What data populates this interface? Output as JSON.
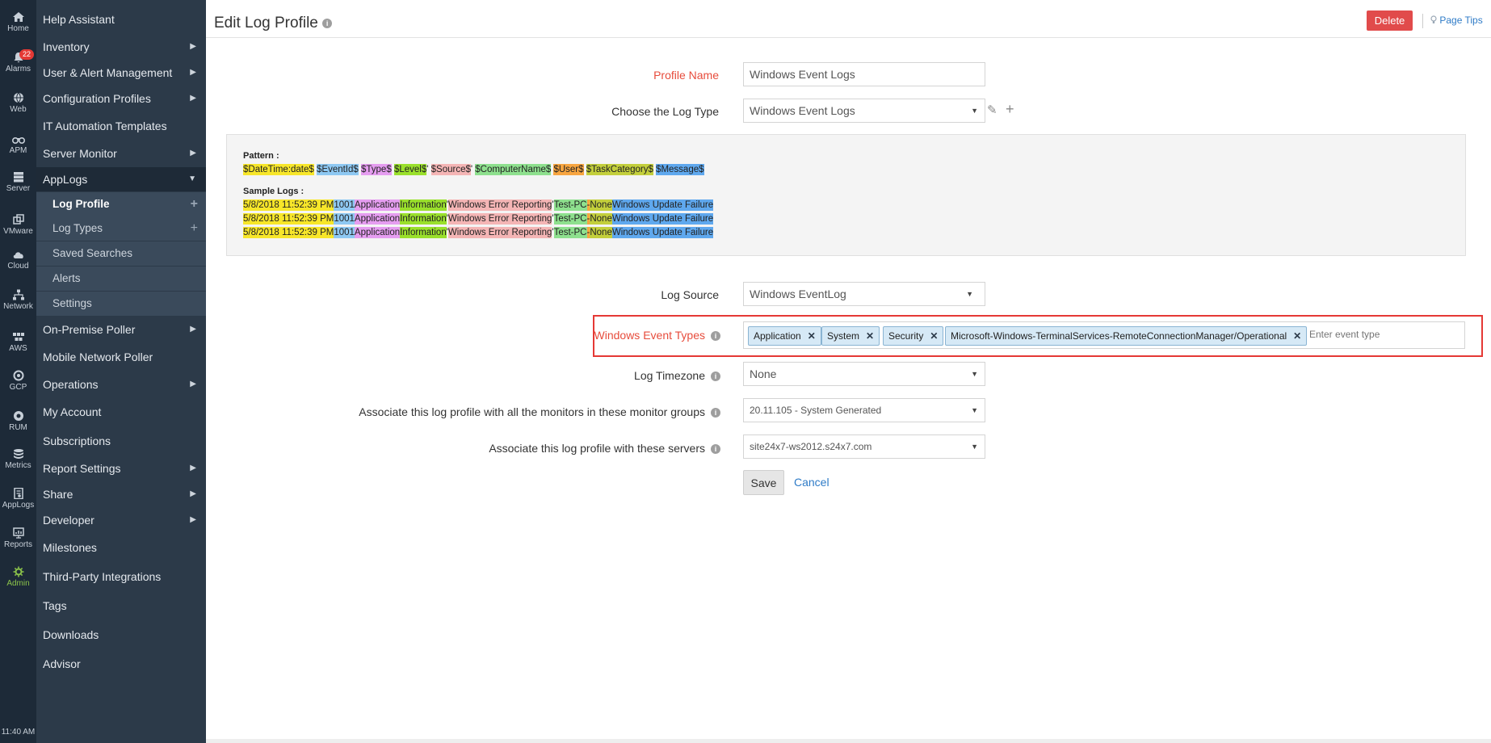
{
  "rail": [
    {
      "label": "Home",
      "icon": "home-icon"
    },
    {
      "label": "Alarms",
      "icon": "bell-icon",
      "badge": "22"
    },
    {
      "label": "Web",
      "icon": "globe-icon"
    },
    {
      "label": "APM",
      "icon": "binoculars-icon"
    },
    {
      "label": "Server",
      "icon": "server-icon"
    },
    {
      "label": "VMware",
      "icon": "vmware-icon"
    },
    {
      "label": "Cloud",
      "icon": "cloud-icon"
    },
    {
      "label": "Network",
      "icon": "network-icon"
    },
    {
      "label": "AWS",
      "icon": "aws-icon"
    },
    {
      "label": "GCP",
      "icon": "gcp-icon"
    },
    {
      "label": "RUM",
      "icon": "rum-icon"
    },
    {
      "label": "Metrics",
      "icon": "metrics-icon"
    },
    {
      "label": "AppLogs",
      "icon": "applogs-icon"
    },
    {
      "label": "Reports",
      "icon": "reports-icon"
    },
    {
      "label": "Admin",
      "icon": "gear-icon"
    }
  ],
  "clock": "11:40 AM",
  "menu": {
    "items": [
      {
        "label": "Help Assistant"
      },
      {
        "label": "Inventory"
      },
      {
        "label": "User & Alert Management"
      },
      {
        "label": "Configuration Profiles"
      },
      {
        "label": "IT Automation Templates"
      },
      {
        "label": "Server Monitor"
      },
      {
        "label": "AppLogs"
      },
      {
        "label": "Log Profile"
      },
      {
        "label": "Log Types"
      },
      {
        "label": "Saved Searches"
      },
      {
        "label": "Alerts"
      },
      {
        "label": "Settings"
      },
      {
        "label": "On-Premise Poller"
      },
      {
        "label": "Mobile Network Poller"
      },
      {
        "label": "Operations"
      },
      {
        "label": "My Account"
      },
      {
        "label": "Subscriptions"
      },
      {
        "label": "Report Settings"
      },
      {
        "label": "Share"
      },
      {
        "label": "Developer"
      },
      {
        "label": "Milestones"
      },
      {
        "label": "Third-Party Integrations"
      },
      {
        "label": "Tags"
      },
      {
        "label": "Downloads"
      },
      {
        "label": "Advisor"
      }
    ]
  },
  "header": {
    "title": "Edit Log Profile",
    "delete_label": "Delete",
    "page_tips_label": "Page Tips"
  },
  "form": {
    "profile_name_label": "Profile Name",
    "profile_name_value": "Windows Event Logs",
    "log_type_label": "Choose the Log Type",
    "log_type_value": "Windows Event Logs",
    "pattern_label": "Pattern :",
    "pattern": {
      "datetime": "$DateTime:date$",
      "eventid": "$EventId$",
      "type": "$Type$",
      "level": "$Level$",
      "sep1": "'",
      "source": "$Source$",
      "sep2": "'",
      "computer": "$ComputerName$",
      "user": "$User$",
      "taskcat": "$TaskCategory$",
      "message": "$Message$"
    },
    "sample_label": "Sample Logs :",
    "samples": [
      {
        "datetime": "5/8/2018 11:52:39 PM",
        "eventid": "1001",
        "type": "Application",
        "level": "Information",
        "sep1": "'",
        "source": "Windows Error Reporting",
        "sep2": "'",
        "computer": "Test-PC",
        "user": "-",
        "taskcat": "None",
        "message": "Windows Update Failure"
      },
      {
        "datetime": "5/8/2018 11:52:39 PM",
        "eventid": "1001",
        "type": "Application",
        "level": "Information",
        "sep1": "'",
        "source": "Windows Error Reporting",
        "sep2": "'",
        "computer": "Test-PC",
        "user": "-",
        "taskcat": "None",
        "message": "Windows Update Failure"
      },
      {
        "datetime": "5/8/2018 11:52:39 PM",
        "eventid": "1001",
        "type": "Application",
        "level": "Information",
        "sep1": "'",
        "source": "Windows Error Reporting",
        "sep2": "'",
        "computer": "Test-PC",
        "user": "-",
        "taskcat": "None",
        "message": "Windows Update Failure"
      }
    ],
    "log_source_label": "Log Source",
    "log_source_value": "Windows EventLog",
    "event_types_label": "Windows Event Types",
    "event_types": [
      "Application",
      "System",
      "Security",
      "Microsoft-Windows-TerminalServices-RemoteConnectionManager/Operational"
    ],
    "event_type_placeholder": "Enter event type",
    "timezone_label": "Log Timezone",
    "timezone_value": "None",
    "monitor_groups_label": "Associate this log profile with all the monitors in these monitor groups",
    "monitor_groups_value": "20.11.105 - System Generated",
    "servers_label": "Associate this log profile with these servers",
    "servers_value": "site24x7-ws2012.s24x7.com",
    "save_label": "Save",
    "cancel_label": "Cancel"
  },
  "colors": {
    "required_label": "#e74c3c",
    "delete_button": "#e14b4b",
    "link": "#2e7bc7",
    "highlight_border": "#e53935"
  }
}
